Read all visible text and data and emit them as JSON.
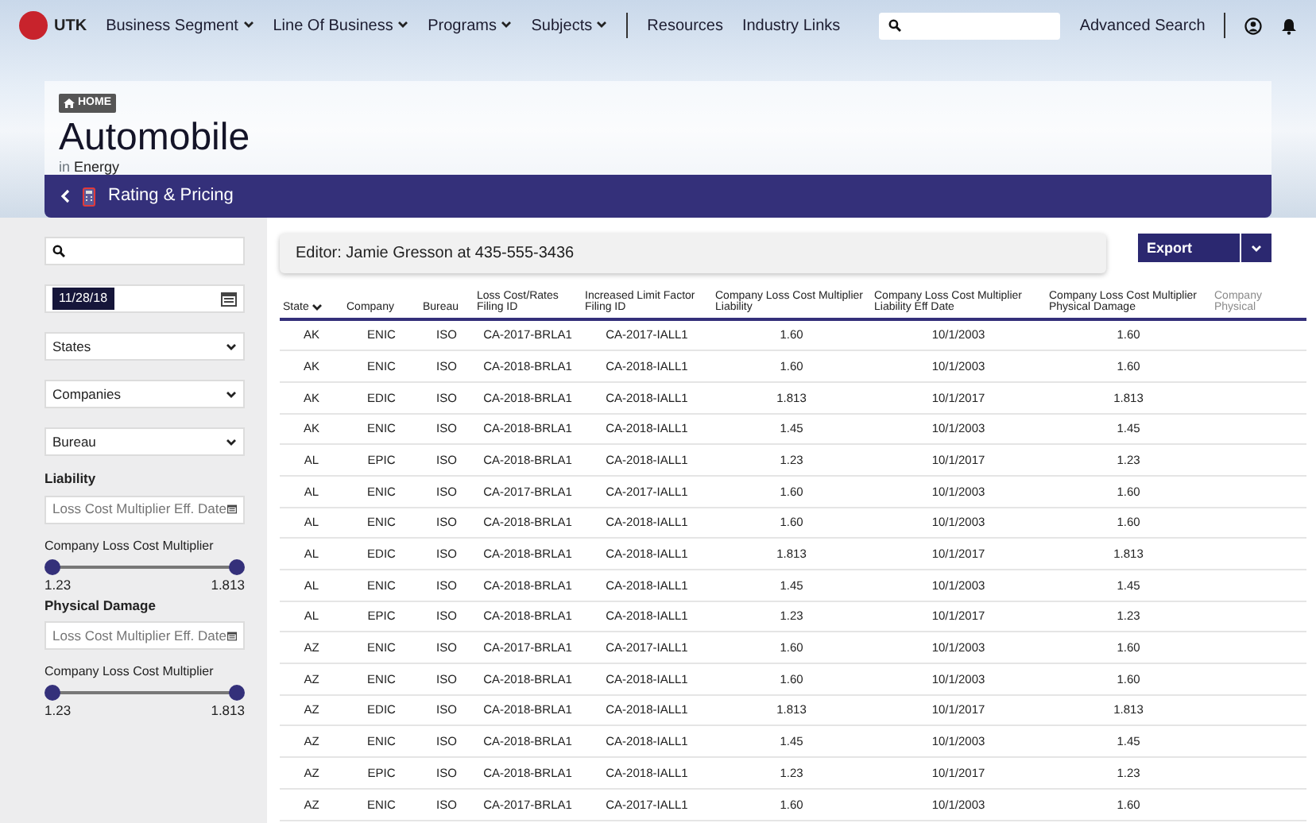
{
  "nav": {
    "logo": "UTK",
    "menus": [
      {
        "label": "Business Segment",
        "dropdown": true
      },
      {
        "label": "Line Of Business",
        "dropdown": true
      },
      {
        "label": "Programs",
        "dropdown": true
      },
      {
        "label": "Subjects",
        "dropdown": true
      },
      {
        "label": "Resources",
        "dropdown": false
      },
      {
        "label": "Industry Links",
        "dropdown": false
      }
    ],
    "advanced_search": "Advanced Search"
  },
  "header": {
    "breadcrumb": "HOME",
    "title": "Automobile",
    "subtitle_prefix": "in",
    "subtitle": "Energy",
    "section": "Rating & Pricing"
  },
  "sidebar": {
    "date": "11/28/18",
    "selects": [
      "States",
      "Companies",
      "Bureau"
    ],
    "groups": [
      {
        "title": "Liability",
        "date_placeholder": "Loss Cost Multiplier Eff. Date",
        "slider_label": "Company Loss Cost Multiplier",
        "thumbs": [
          {
            "level": 0
          },
          {
            "level": 1
          }
        ],
        "min": "1.23",
        "max": "1.813"
      },
      {
        "title": "Physical Damage",
        "date_placeholder": "Loss Cost Multiplier Eff. Date",
        "slider_label": "Company Loss Cost Multiplier",
        "thumbs": [
          {
            "level": 0
          },
          {
            "level": 1
          }
        ],
        "min": "1.23",
        "max": "1.813"
      }
    ]
  },
  "editor": "Editor: Jamie Gresson at 435-555-3436",
  "export": "Export",
  "table": {
    "columns": [
      {
        "label": "State",
        "sorted": true
      },
      {
        "label": "Company",
        "sorted": false
      },
      {
        "label": "Bureau",
        "sorted": false
      },
      {
        "label": "Loss Cost/Rates Filing ID",
        "sorted": false
      },
      {
        "label": "Increased Limit Factor Filing ID",
        "sorted": false
      },
      {
        "label": "Company Loss Cost Multiplier Liability",
        "sorted": false
      },
      {
        "label": "Company Loss Cost Multiplier Liability Eff Date",
        "sorted": false
      },
      {
        "label": "Company Loss Cost Multiplier Physical Damage",
        "sorted": false
      },
      {
        "label": "Company Physical",
        "sorted": false
      }
    ],
    "rows": [
      [
        "AK",
        "ENIC",
        "ISO",
        "CA-2017-BRLA1",
        "CA-2017-IALL1",
        "1.60",
        "10/1/2003",
        "1.60"
      ],
      [
        "AK",
        "ENIC",
        "ISO",
        "CA-2018-BRLA1",
        "CA-2018-IALL1",
        "1.60",
        "10/1/2003",
        "1.60"
      ],
      [
        "AK",
        "EDIC",
        "ISO",
        "CA-2018-BRLA1",
        "CA-2018-IALL1",
        "1.813",
        "10/1/2017",
        "1.813"
      ],
      [
        "AK",
        "ENIC",
        "ISO",
        "CA-2018-BRLA1",
        "CA-2018-IALL1",
        "1.45",
        "10/1/2003",
        "1.45"
      ],
      [
        "AL",
        "EPIC",
        "ISO",
        "CA-2018-BRLA1",
        "CA-2018-IALL1",
        "1.23",
        "10/1/2017",
        "1.23"
      ],
      [
        "AL",
        "ENIC",
        "ISO",
        "CA-2017-BRLA1",
        "CA-2017-IALL1",
        "1.60",
        "10/1/2003",
        "1.60"
      ],
      [
        "AL",
        "ENIC",
        "ISO",
        "CA-2018-BRLA1",
        "CA-2018-IALL1",
        "1.60",
        "10/1/2003",
        "1.60"
      ],
      [
        "AL",
        "EDIC",
        "ISO",
        "CA-2018-BRLA1",
        "CA-2018-IALL1",
        "1.813",
        "10/1/2017",
        "1.813"
      ],
      [
        "AL",
        "ENIC",
        "ISO",
        "CA-2018-BRLA1",
        "CA-2018-IALL1",
        "1.45",
        "10/1/2003",
        "1.45"
      ],
      [
        "AL",
        "EPIC",
        "ISO",
        "CA-2018-BRLA1",
        "CA-2018-IALL1",
        "1.23",
        "10/1/2017",
        "1.23"
      ],
      [
        "AZ",
        "ENIC",
        "ISO",
        "CA-2017-BRLA1",
        "CA-2017-IALL1",
        "1.60",
        "10/1/2003",
        "1.60"
      ],
      [
        "AZ",
        "ENIC",
        "ISO",
        "CA-2018-BRLA1",
        "CA-2018-IALL1",
        "1.60",
        "10/1/2003",
        "1.60"
      ],
      [
        "AZ",
        "EDIC",
        "ISO",
        "CA-2018-BRLA1",
        "CA-2018-IALL1",
        "1.813",
        "10/1/2017",
        "1.813"
      ],
      [
        "AZ",
        "ENIC",
        "ISO",
        "CA-2018-BRLA1",
        "CA-2018-IALL1",
        "1.45",
        "10/1/2003",
        "1.45"
      ],
      [
        "AZ",
        "EPIC",
        "ISO",
        "CA-2018-BRLA1",
        "CA-2018-IALL1",
        "1.23",
        "10/1/2017",
        "1.23"
      ],
      [
        "AZ",
        "ENIC",
        "ISO",
        "CA-2017-BRLA1",
        "CA-2017-IALL1",
        "1.60",
        "10/1/2003",
        "1.60"
      ]
    ]
  }
}
